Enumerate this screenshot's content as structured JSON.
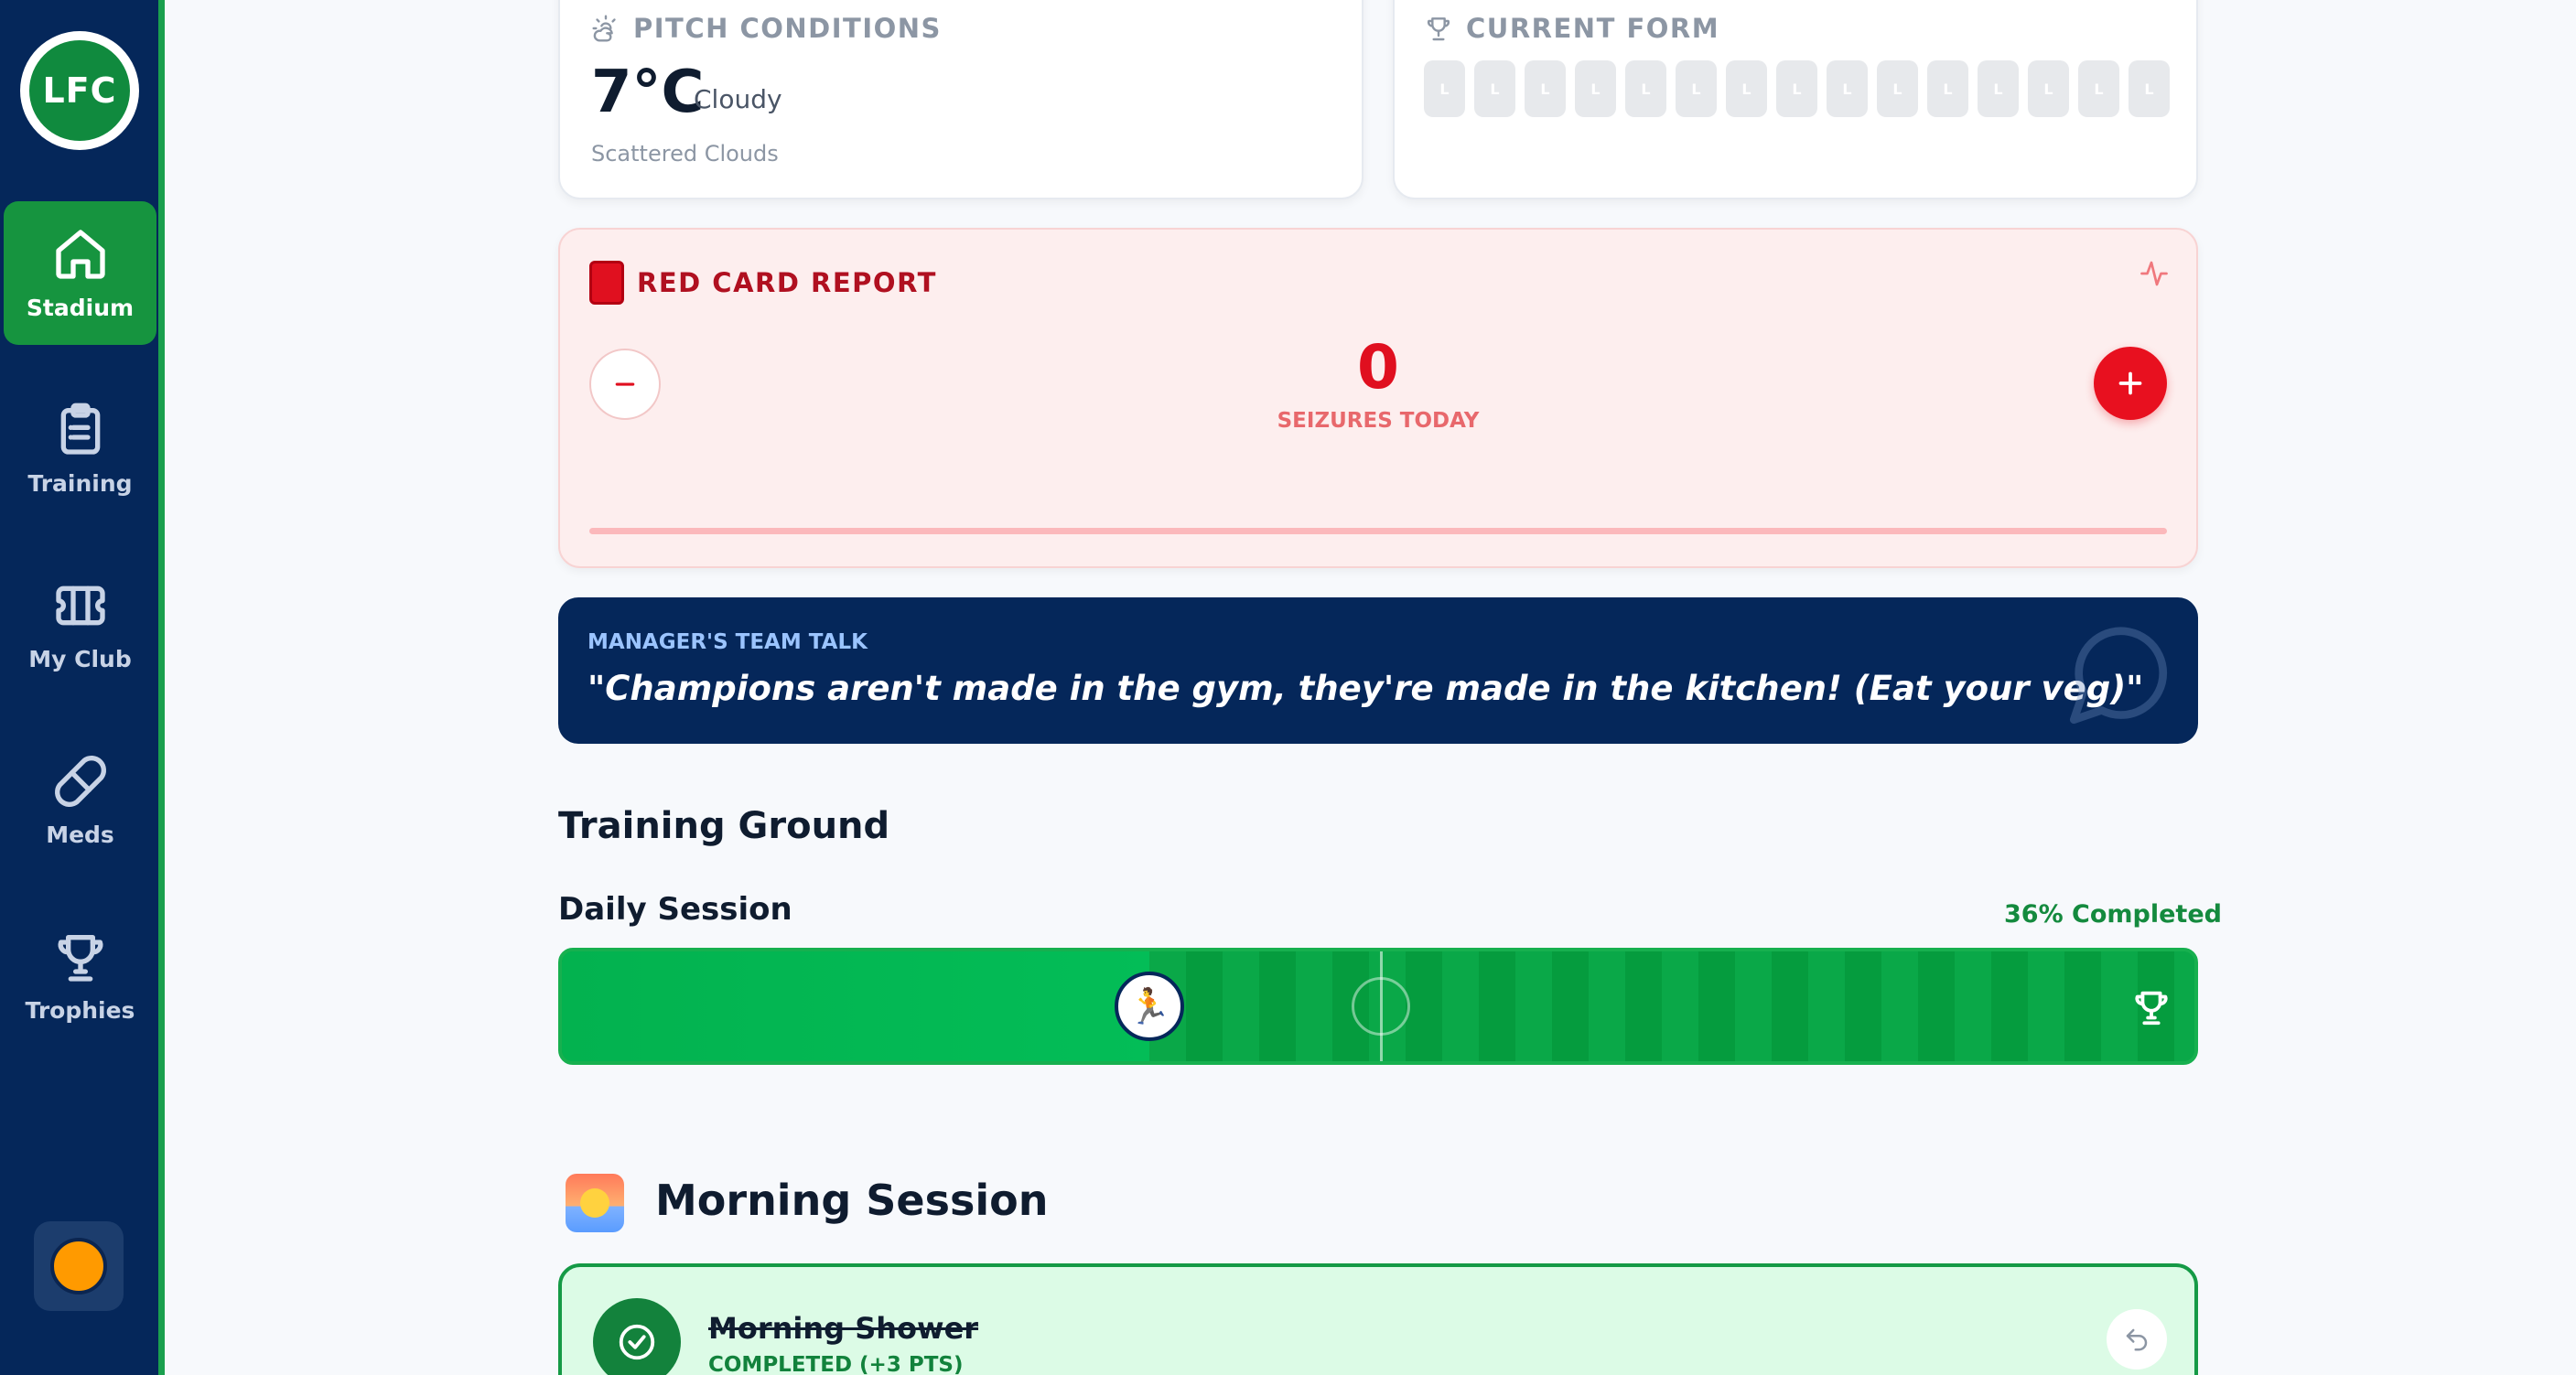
{
  "sidebar": {
    "logo_text": "LFC",
    "items": [
      {
        "label": "Stadium",
        "icon": "home-icon",
        "active": true
      },
      {
        "label": "Training",
        "icon": "clipboard-icon",
        "active": false
      },
      {
        "label": "My Club",
        "icon": "ticket-icon",
        "active": false
      },
      {
        "label": "Meds",
        "icon": "pill-icon",
        "active": false
      },
      {
        "label": "Trophies",
        "icon": "trophy-icon",
        "active": false
      }
    ],
    "avatar_color": "#ff9a00"
  },
  "weather": {
    "title": "PITCH CONDITIONS",
    "temp": "7°C",
    "condition": "Cloudy",
    "detail": "Scattered Clouds"
  },
  "form": {
    "title": "CURRENT FORM",
    "results": [
      "L",
      "L",
      "L",
      "L",
      "L",
      "L",
      "L",
      "L",
      "L",
      "L",
      "L",
      "L",
      "L",
      "L",
      "L"
    ]
  },
  "red_card": {
    "title": "RED CARD REPORT",
    "count": "0",
    "count_label": "SEIZURES TODAY",
    "accent": "#e00f1f"
  },
  "team_talk": {
    "label": "MANAGER'S TEAM TALK",
    "quote": "\"Champions aren't made in the gym, they're made in the kitchen! (Eat your veg)\""
  },
  "training": {
    "heading": "Training Ground",
    "session_label": "Daily Session",
    "progress_text": "36% Completed",
    "progress": 0.36
  },
  "morning": {
    "heading": "Morning Session",
    "tasks": [
      {
        "title": "Morning Shower",
        "status": "COMPLETED (+3 PTS)"
      }
    ]
  },
  "colors": {
    "navy": "#05275a",
    "green": "#16943f",
    "red": "#e8101f"
  }
}
